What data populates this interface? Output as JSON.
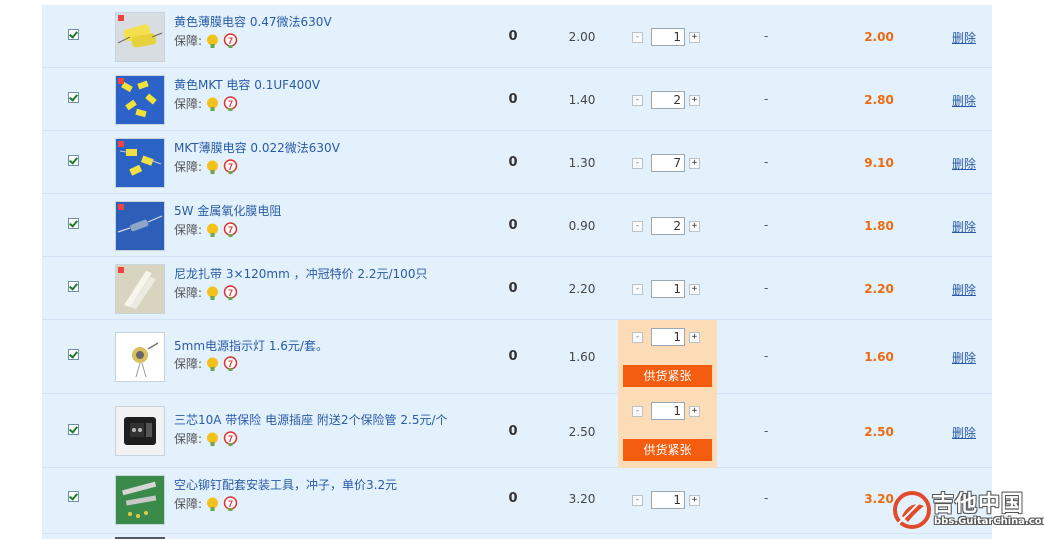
{
  "cart": {
    "guarantee_label": "保障:",
    "items": [
      {
        "title": "黄色薄膜电容 0.47微法630V",
        "qty0": "0",
        "price": "2.00",
        "minus": "-",
        "plus": "+",
        "quantity": "1",
        "dash": "-",
        "subtotal": "2.00",
        "delete": "删除"
      },
      {
        "title": "黄色MKT 电容 0.1UF400V",
        "qty0": "0",
        "price": "1.40",
        "minus": "-",
        "plus": "+",
        "quantity": "2",
        "dash": "-",
        "subtotal": "2.80",
        "delete": "删除"
      },
      {
        "title": "MKT薄膜电容 0.022微法630V",
        "qty0": "0",
        "price": "1.30",
        "minus": "-",
        "plus": "+",
        "quantity": "7",
        "dash": "-",
        "subtotal": "9.10",
        "delete": "删除"
      },
      {
        "title": "5W 金属氧化膜电阻",
        "qty0": "0",
        "price": "0.90",
        "minus": "-",
        "plus": "+",
        "quantity": "2",
        "dash": "-",
        "subtotal": "1.80",
        "delete": "删除"
      },
      {
        "title": "尼龙扎带 3×120mm ，冲冠特价 2.2元/100只",
        "qty0": "0",
        "price": "2.20",
        "minus": "-",
        "plus": "+",
        "quantity": "1",
        "dash": "-",
        "subtotal": "2.20",
        "delete": "删除"
      },
      {
        "title": "5mm电源指示灯 1.6元/套。",
        "qty0": "0",
        "price": "1.60",
        "minus": "-",
        "plus": "+",
        "quantity": "1",
        "dash": "-",
        "subtotal": "1.60",
        "delete": "删除",
        "stock_warning": "供货紧张"
      },
      {
        "title": "三芯10A 带保险 电源插座 附送2个保险管 2.5元/个",
        "qty0": "0",
        "price": "2.50",
        "minus": "-",
        "plus": "+",
        "quantity": "1",
        "dash": "-",
        "subtotal": "2.50",
        "delete": "删除",
        "stock_warning": "供货紧张"
      },
      {
        "title": "空心铆钉配套安装工具，冲子，单价3.2元",
        "qty0": "0",
        "price": "3.20",
        "minus": "-",
        "plus": "+",
        "quantity": "1",
        "dash": "-",
        "subtotal": "3.20",
        "delete": "删除"
      }
    ]
  },
  "watermark": {
    "text": "吉他中国",
    "url_text": "bbs.GuitarChina.com"
  },
  "colors": {
    "row_bg": "#e3f1fd",
    "accent_orange": "#ee6a0f",
    "stock_button": "#f45c10",
    "stock_cell": "#fcdcb7",
    "link": "#2a5aa6"
  }
}
